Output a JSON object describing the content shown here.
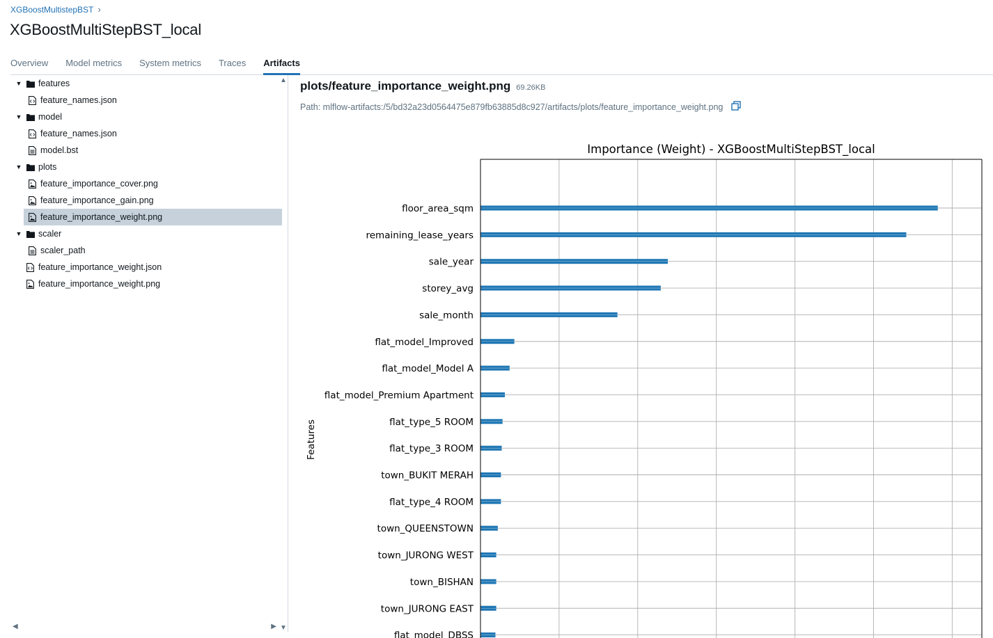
{
  "breadcrumb": {
    "parent": "XGBoostMultistepBST",
    "separator": "›"
  },
  "page": {
    "title": "XGBoostMultiStepBST_local"
  },
  "tabs": [
    {
      "label": "Overview",
      "active": false
    },
    {
      "label": "Model metrics",
      "active": false
    },
    {
      "label": "System metrics",
      "active": false
    },
    {
      "label": "Traces",
      "active": false
    },
    {
      "label": "Artifacts",
      "active": true
    }
  ],
  "tree": [
    {
      "label": "features",
      "kind": "folder",
      "depth": 0,
      "expanded": true
    },
    {
      "label": "feature_names.json",
      "kind": "code-file",
      "depth": 1
    },
    {
      "label": "model",
      "kind": "folder",
      "depth": 0,
      "expanded": true
    },
    {
      "label": "feature_names.json",
      "kind": "code-file",
      "depth": 1
    },
    {
      "label": "model.bst",
      "kind": "file",
      "depth": 1
    },
    {
      "label": "plots",
      "kind": "folder",
      "depth": 0,
      "expanded": true
    },
    {
      "label": "feature_importance_cover.png",
      "kind": "image-file",
      "depth": 1
    },
    {
      "label": "feature_importance_gain.png",
      "kind": "image-file",
      "depth": 1
    },
    {
      "label": "feature_importance_weight.png",
      "kind": "image-file",
      "depth": 1,
      "selected": true
    },
    {
      "label": "scaler",
      "kind": "folder",
      "depth": 0,
      "expanded": true
    },
    {
      "label": "scaler_path",
      "kind": "file",
      "depth": 1
    },
    {
      "label": "feature_importance_weight.json",
      "kind": "code-file",
      "depth": 0
    },
    {
      "label": "feature_importance_weight.png",
      "kind": "image-file",
      "depth": 0
    }
  ],
  "preview": {
    "file_title": "plots/feature_importance_weight.png",
    "file_size": "69.26KB",
    "path_label": "Path: mlflow-artifacts:/5/bd32a23d0564475e879fb63885d8c927/artifacts/plots/feature_importance_weight.png"
  },
  "colors": {
    "accent": "#2272b4",
    "bar": "#1f77b4",
    "selected_row": "#c6d1db"
  },
  "chart_data": {
    "type": "bar",
    "orientation": "horizontal",
    "title": "Importance (Weight) - XGBoostMultiStepBST_local",
    "ylabel": "Features",
    "xlabel": "",
    "grid": true,
    "categories": [
      "floor_area_sqm",
      "remaining_lease_years",
      "sale_year",
      "storey_avg",
      "sale_month",
      "flat_model_Improved",
      "flat_model_Model A",
      "flat_model_Premium Apartment",
      "flat_type_5 ROOM",
      "flat_type_3 ROOM",
      "town_BUKIT MERAH",
      "flat_type_4 ROOM",
      "town_QUEENSTOWN",
      "town_JURONG WEST",
      "town_BISHAN",
      "town_JURONG EAST",
      "flat_model_DBSS"
    ],
    "values": [
      581,
      541,
      238,
      229,
      174,
      43,
      37,
      31,
      28,
      27,
      26,
      26,
      22,
      20,
      20,
      20,
      19
    ],
    "xlim": [
      0,
      637
    ]
  }
}
